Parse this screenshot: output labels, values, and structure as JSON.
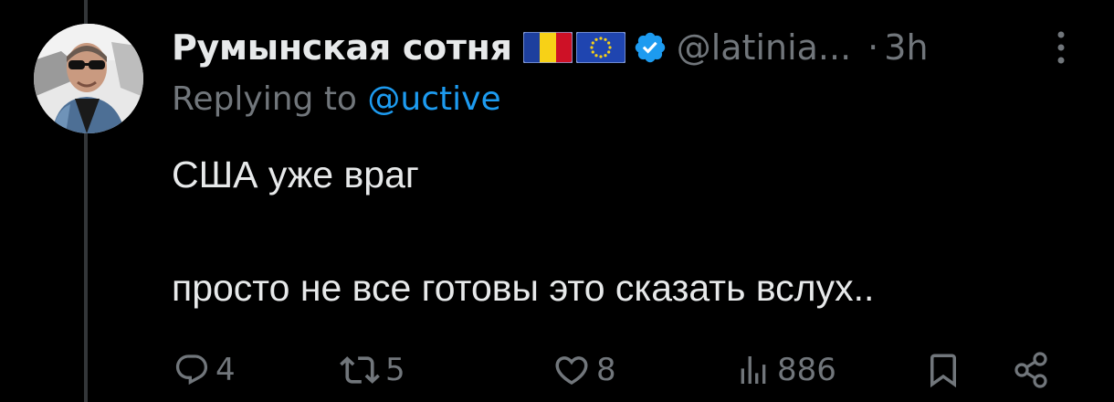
{
  "tweet": {
    "author": {
      "display_name": "Румынская сотня",
      "handle": "@latinia...",
      "flags": [
        "romania-flag-icon",
        "eu-flag-icon"
      ],
      "verified_badge": "verified-badge-icon"
    },
    "separator": "·",
    "time": "3h",
    "replying_prefix": "Replying to ",
    "replying_to": "@uctive",
    "text": "США уже враг\n\nпросто не все готовы это сказать вслух..",
    "actions": {
      "replies": "4",
      "retweets": "5",
      "likes": "8",
      "views": "886"
    }
  },
  "colors": {
    "background": "#000000",
    "text_primary": "#e7e9ea",
    "text_secondary": "#71767b",
    "accent": "#1d9bf0",
    "thread_line": "#333639"
  }
}
